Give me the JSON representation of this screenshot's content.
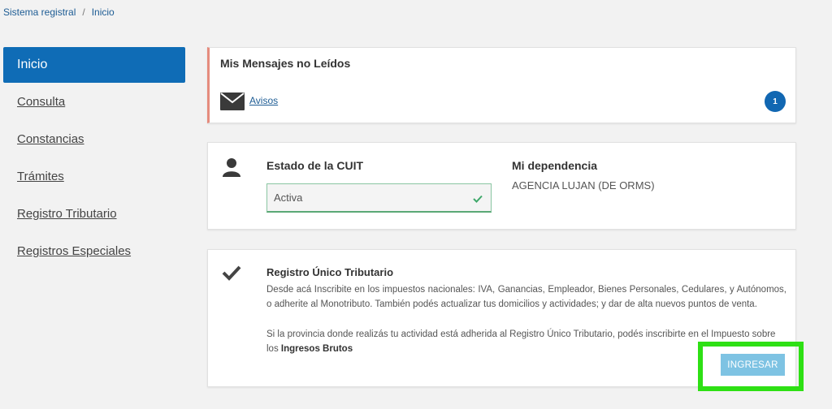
{
  "breadcrumb": {
    "root": "Sistema registral",
    "separator": "/",
    "current": "Inicio"
  },
  "sidebar": {
    "items": [
      {
        "label": "Inicio"
      },
      {
        "label": "Consulta"
      },
      {
        "label": "Constancias"
      },
      {
        "label": "Trámites"
      },
      {
        "label": "Registro Tributario"
      },
      {
        "label": "Registros Especiales"
      }
    ]
  },
  "messages": {
    "title": "Mis Mensajes no Leídos",
    "link": "Avisos",
    "badge": "1",
    "icon": "envelope-icon"
  },
  "cuit": {
    "label": "Estado de la CUIT",
    "value": "Activa",
    "dependency_label": "Mi dependencia",
    "dependency_value": "AGENCIA LUJAN (DE ORMS)"
  },
  "rut": {
    "title": "Registro Único Tributario",
    "description_1": "Desde acá Inscribite en los impuestos nacionales: IVA, Ganancias, Empleador, Bienes Personales, Cedulares, y Autónomos, o adherite al Monotributo. También podés actualizar tus domicilios y actividades; y dar de alta nuevos puntos de venta.",
    "description_2_prefix": "Si la provincia donde realizás tu actividad está adherida al Registro Único Tributario, podés inscribirte en el Impuesto sobre los ",
    "description_2_bold": "Ingresos Brutos",
    "button": "INGRESAR"
  },
  "colors": {
    "primary": "#0f6cb6",
    "highlight": "#2ee014",
    "button": "#7ec3e3",
    "accent_border": "#e58c7e"
  }
}
